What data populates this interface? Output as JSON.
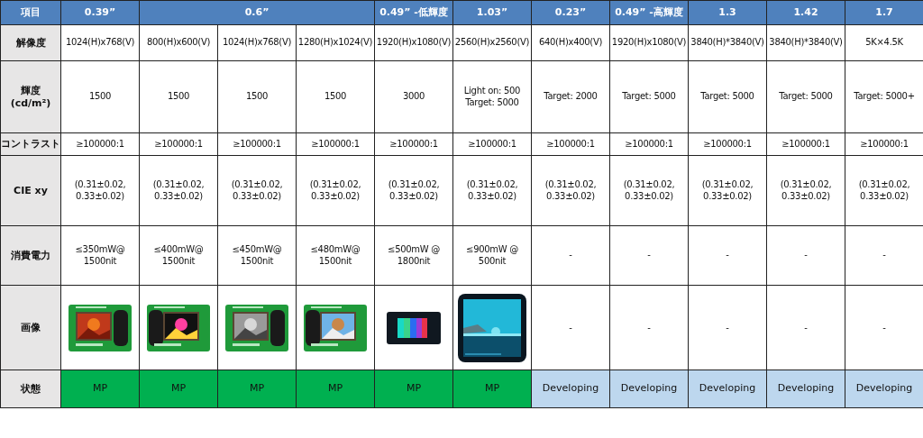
{
  "table": {
    "corner": "項目",
    "row_labels": [
      "解像度",
      "輝度\n(cd/m²)",
      "コントラスト",
      "CIE xy",
      "消費電力",
      "画像",
      "状態"
    ],
    "groups": [
      {
        "title": "0.39”",
        "columns": [
          {
            "resolution": "1024(H)x768(V)",
            "brightness": "1500",
            "contrast": "≥100000:1",
            "cie": "(0.31±0.02,\n0.33±0.02)",
            "power": "≤350mW@\n1500nit",
            "status": {
              "text": "MP",
              "color": "#00b050"
            }
          }
        ]
      },
      {
        "title": "0.6”",
        "columns": [
          {
            "resolution": "800(H)x600(V)",
            "brightness": "1500",
            "contrast": "≥100000:1",
            "cie": "(0.31±0.02,\n0.33±0.02)",
            "power": "≤400mW@\n1500nit",
            "status": {
              "text": "MP",
              "color": "#00b050"
            }
          },
          {
            "resolution": "1024(H)x768(V)",
            "brightness": "1500",
            "contrast": "≥100000:1",
            "cie": "(0.31±0.02,\n0.33±0.02)",
            "power": "≤450mW@\n1500nit",
            "status": {
              "text": "MP",
              "color": "#00b050"
            }
          },
          {
            "resolution": "1280(H)x1024(V)",
            "brightness": "1500",
            "contrast": "≥100000:1",
            "cie": "(0.31±0.02,\n0.33±0.02)",
            "power": "≤480mW@\n1500nit",
            "status": {
              "text": "MP",
              "color": "#00b050"
            }
          }
        ]
      },
      {
        "title": "0.49” -低輝度",
        "columns": [
          {
            "resolution": "1920(H)x1080(V)",
            "brightness": "3000",
            "contrast": "≥100000:1",
            "cie": "(0.31±0.02,\n0.33±0.02)",
            "power": "≤500mW @\n1800nit",
            "status": {
              "text": "MP",
              "color": "#00b050"
            }
          }
        ]
      },
      {
        "title": "1.03”",
        "columns": [
          {
            "resolution": "2560(H)x2560(V)",
            "brightness": "Light on: 500\nTarget: 5000",
            "contrast": "≥100000:1",
            "cie": "(0.31±0.02,\n0.33±0.02)",
            "power": "≤900mW @\n500nit",
            "status": {
              "text": "MP",
              "color": "#00b050"
            }
          }
        ]
      },
      {
        "title": "0.23”",
        "columns": [
          {
            "resolution": "640(H)x400(V)",
            "brightness": "Target: 2000",
            "contrast": "≥100000:1",
            "cie": "(0.31±0.02,\n0.33±0.02)",
            "power": "-",
            "image": {
              "kind": "text",
              "text": "-"
            },
            "status": {
              "text": "Developing",
              "color": "#bdd7ee"
            }
          }
        ]
      },
      {
        "title": "0.49” -高輝度",
        "columns": [
          {
            "resolution": "1920(H)x1080(V)",
            "brightness": "Target: 5000",
            "contrast": "≥100000:1",
            "cie": "(0.31±0.02,\n0.33±0.02)",
            "power": "-",
            "image": {
              "kind": "text",
              "text": "-"
            },
            "status": {
              "text": "Developing",
              "color": "#bdd7ee"
            }
          }
        ]
      },
      {
        "title": "1.3",
        "columns": [
          {
            "resolution": "3840(H)*3840(V)",
            "brightness": "Target: 5000",
            "contrast": "≥100000:1",
            "cie": "(0.31±0.02,\n0.33±0.02)",
            "power": "-",
            "image": {
              "kind": "text",
              "text": "-"
            },
            "status": {
              "text": "Developing",
              "color": "#bdd7ee"
            }
          }
        ]
      },
      {
        "title": "1.42",
        "columns": [
          {
            "resolution": "3840(H)*3840(V)",
            "brightness": "Target: 5000",
            "contrast": "≥100000:1",
            "cie": "(0.31±0.02,\n0.33±0.02)",
            "power": "-",
            "image": {
              "kind": "text",
              "text": "-"
            },
            "status": {
              "text": "Developing",
              "color": "#bdd7ee"
            }
          }
        ]
      },
      {
        "title": "1.7",
        "columns": [
          {
            "resolution": "5K×4.5K",
            "brightness": "Target: 5000+",
            "contrast": "≥100000:1",
            "cie": "(0.31±0.02,\n0.33±0.02)",
            "power": "-",
            "image": {
              "kind": "text",
              "text": "-"
            },
            "status": {
              "text": "Developing",
              "color": "#bdd7ee"
            }
          }
        ]
      }
    ]
  }
}
